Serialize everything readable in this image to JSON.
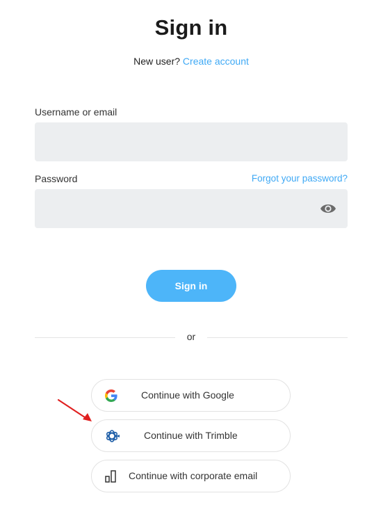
{
  "header": {
    "title": "Sign in",
    "new_user_text": "New user?",
    "create_account_link": "Create account"
  },
  "form": {
    "username_label": "Username or email",
    "username_value": "",
    "password_label": "Password",
    "password_value": "",
    "forgot_password_link": "Forgot your password?",
    "password_toggle_icon": "eye-icon",
    "submit_label": "Sign in"
  },
  "divider": {
    "text": "or"
  },
  "sso": [
    {
      "label": "Continue with Google",
      "icon": "google-icon"
    },
    {
      "label": "Continue with Trimble",
      "icon": "trimble-icon"
    },
    {
      "label": "Continue with corporate email",
      "icon": "building-icon"
    }
  ],
  "annotation": {
    "icon": "red-arrow-annotation",
    "color": "#e02020"
  },
  "colors": {
    "accent": "#3fa9f5",
    "button": "#4db5f9",
    "input_bg": "#eceef0"
  }
}
